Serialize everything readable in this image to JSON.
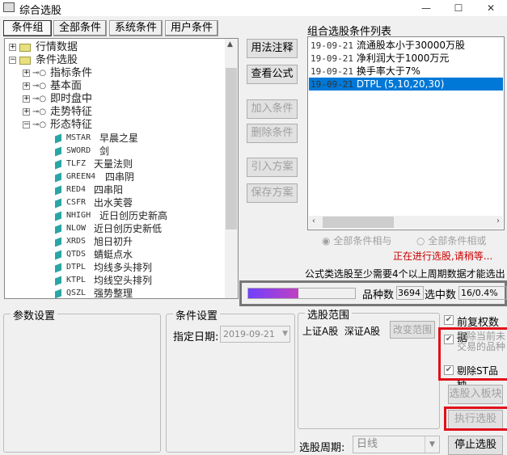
{
  "window": {
    "title": "综合选股",
    "minimize": "—",
    "maximize": "☐",
    "close": "✕"
  },
  "tabs": [
    {
      "label": "条件组"
    },
    {
      "label": "全部条件"
    },
    {
      "label": "系统条件"
    },
    {
      "label": "用户条件"
    }
  ],
  "tree": {
    "folders": [
      {
        "label": "行情数据",
        "expanded": false
      },
      {
        "label": "条件选股",
        "expanded": true
      }
    ],
    "categories": [
      {
        "label": "指标条件"
      },
      {
        "label": "基本面"
      },
      {
        "label": "即时盘中"
      },
      {
        "label": "走势特征"
      },
      {
        "label": "形态特征"
      }
    ],
    "items": [
      {
        "code": "MSTAR",
        "name": "早晨之星"
      },
      {
        "code": "SWORD",
        "name": "剑"
      },
      {
        "code": "TLFZ",
        "name": "天量法则"
      },
      {
        "code": "GREEN4",
        "name": "四串阴"
      },
      {
        "code": "RED4",
        "name": "四串阳"
      },
      {
        "code": "CSFR",
        "name": "出水芙蓉"
      },
      {
        "code": "NHIGH",
        "name": "近日创历史新高"
      },
      {
        "code": "NLOW",
        "name": "近日创历史新低"
      },
      {
        "code": "XRDS",
        "name": "旭日初升"
      },
      {
        "code": "QTDS",
        "name": "蜻蜓点水"
      },
      {
        "code": "DTPL",
        "name": "均线多头排列"
      },
      {
        "code": "KTPL",
        "name": "均线空头排列"
      },
      {
        "code": "QSZL",
        "name": "强势整理"
      }
    ]
  },
  "buttons": {
    "usage": "用法注释",
    "view_formula": "查看公式",
    "add": "加入条件",
    "delete": "删除条件",
    "import": "引入方案",
    "save": "保存方案"
  },
  "condition_list": {
    "title": "组合选股条件列表",
    "items": [
      {
        "date": "19-09-21",
        "text": "流通股本小于30000万股"
      },
      {
        "date": "19-09-21",
        "text": "净利润大于1000万元"
      },
      {
        "date": "19-09-21",
        "text": "换手率大于7%"
      },
      {
        "date": "19-09-21",
        "text": "DTPL (5,10,20,30)",
        "selected": true
      }
    ]
  },
  "logic": {
    "and_label": "全部条件相与",
    "or_label": "全部条件相或",
    "selected": "and"
  },
  "status_text": "正在进行选股,请稍等...",
  "notice": "公式类选股至少需要4个以上周期数据才能选出",
  "progress": {
    "percent": 47,
    "count_label": "品种数",
    "count": "3694",
    "selected_label": "选中数",
    "selected": "16/0.4%"
  },
  "params": {
    "title": "参数设置"
  },
  "cond_settings": {
    "title": "条件设置",
    "date_label": "指定日期:",
    "date": "2019-09-21"
  },
  "scope": {
    "title": "选股范围",
    "markets": "上证A股  深证A股",
    "change": "改变范围",
    "period_label": "选股周期:",
    "period": "日线"
  },
  "options": [
    {
      "label": "前复权数据",
      "checked": true
    },
    {
      "label": "剔除当前未交易的品种",
      "checked": true
    },
    {
      "label": "剔除ST品种",
      "checked": true
    }
  ],
  "actions": {
    "to_block": "选股入板块",
    "execute": "执行选股",
    "stop": "停止选股"
  },
  "colors": {
    "selection": "#0078d7",
    "status_red": "#cc0000",
    "highlight_box": "#e0101a",
    "progress_start": "#7040ff",
    "progress_end": "#c040c0"
  }
}
